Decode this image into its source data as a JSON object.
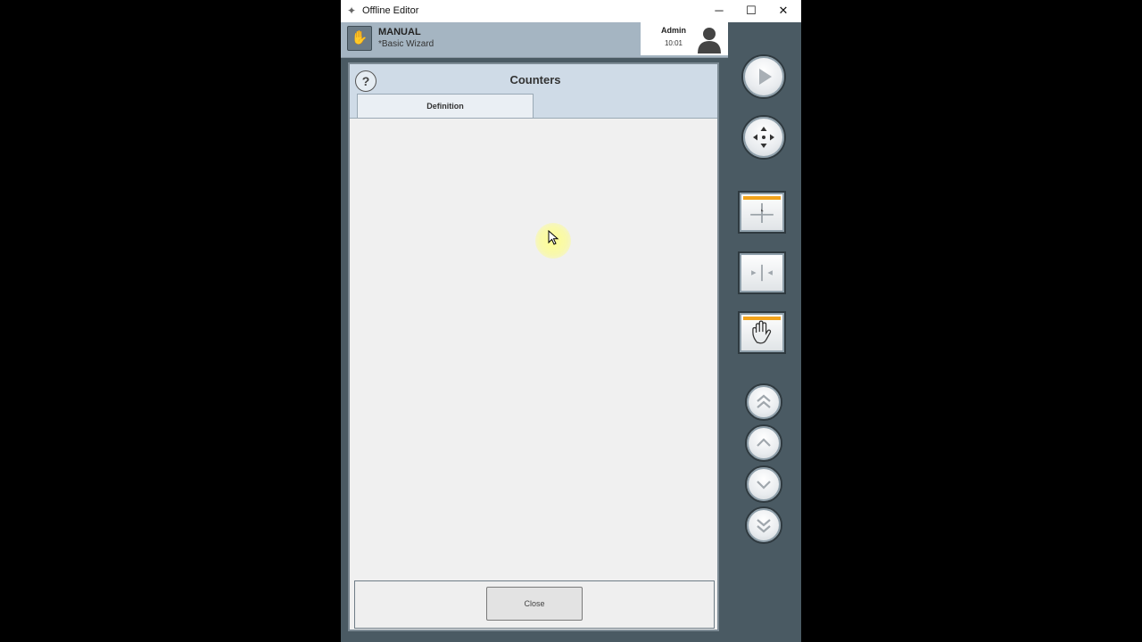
{
  "window": {
    "title": "Offline Editor",
    "minimize": "─",
    "maximize": "☐",
    "close": "✕"
  },
  "mode": {
    "name": "MANUAL",
    "sub": "*Basic Wizard",
    "icon": "hand-icon"
  },
  "user": {
    "name": "Admin",
    "time": "10:01",
    "icon": "user-avatar-icon"
  },
  "dialog": {
    "help": "?",
    "title": "Counters",
    "tab": "Definition",
    "close": "Close"
  },
  "sidebar": {
    "buttons": [
      {
        "name": "play-button",
        "icon": "play-icon"
      },
      {
        "name": "jog-button",
        "icon": "move-arrows-icon"
      },
      {
        "name": "origin-mode-button",
        "icon": "crosshair-icon",
        "active": true
      },
      {
        "name": "measure-mode-button",
        "icon": "arrows-inward-icon",
        "active": false
      },
      {
        "name": "manual-mode-button",
        "icon": "hand-icon",
        "active": true
      },
      {
        "name": "page-up-fast-button",
        "icon": "double-chevron-up-icon"
      },
      {
        "name": "page-up-button",
        "icon": "chevron-up-icon"
      },
      {
        "name": "page-down-button",
        "icon": "chevron-down-icon"
      },
      {
        "name": "page-down-fast-button",
        "icon": "double-chevron-down-icon"
      }
    ]
  }
}
